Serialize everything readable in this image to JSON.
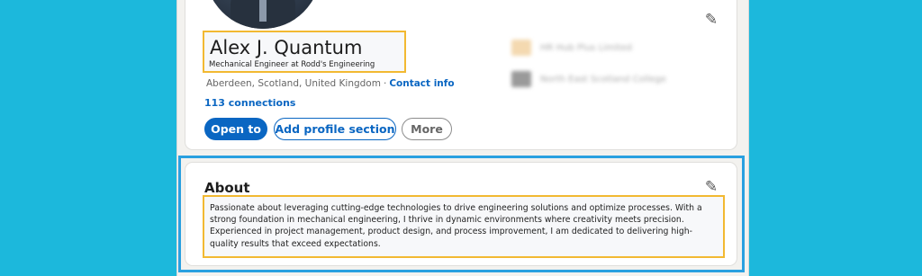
{
  "profile": {
    "name": "Alex J. Quantum",
    "headline": "Mechanical Engineer at Rodd's Engineering",
    "location": "Aberdeen, Scotland, United Kingdom",
    "location_separator": "·",
    "contact_info_label": "Contact info",
    "connections": "113 connections"
  },
  "actions": {
    "open_to_label": "Open to",
    "add_section_label": "Add profile section",
    "more_label": "More"
  },
  "experience_preview": [
    {
      "company": "HR Hub Plus Limited",
      "logo_color": "#f4d9b0"
    },
    {
      "company": "North East Scotland College",
      "logo_color": "#9a9a9a"
    }
  ],
  "about": {
    "title": "About",
    "text": "Passionate about leveraging cutting-edge technologies to drive engineering solutions and optimize processes. With a strong foundation in mechanical engineering, I thrive in dynamic environments where creativity meets precision. Experienced in project management, product design, and process improvement, I am dedicated to delivering high-quality results that exceed expectations."
  },
  "icons": {
    "edit_intro": "pencil-icon",
    "edit_about": "pencil-icon"
  },
  "colors": {
    "background": "#1cb8dc",
    "primary": "#0a66c2",
    "highlight": "#f2b932",
    "frame": "#2aa0e0"
  }
}
